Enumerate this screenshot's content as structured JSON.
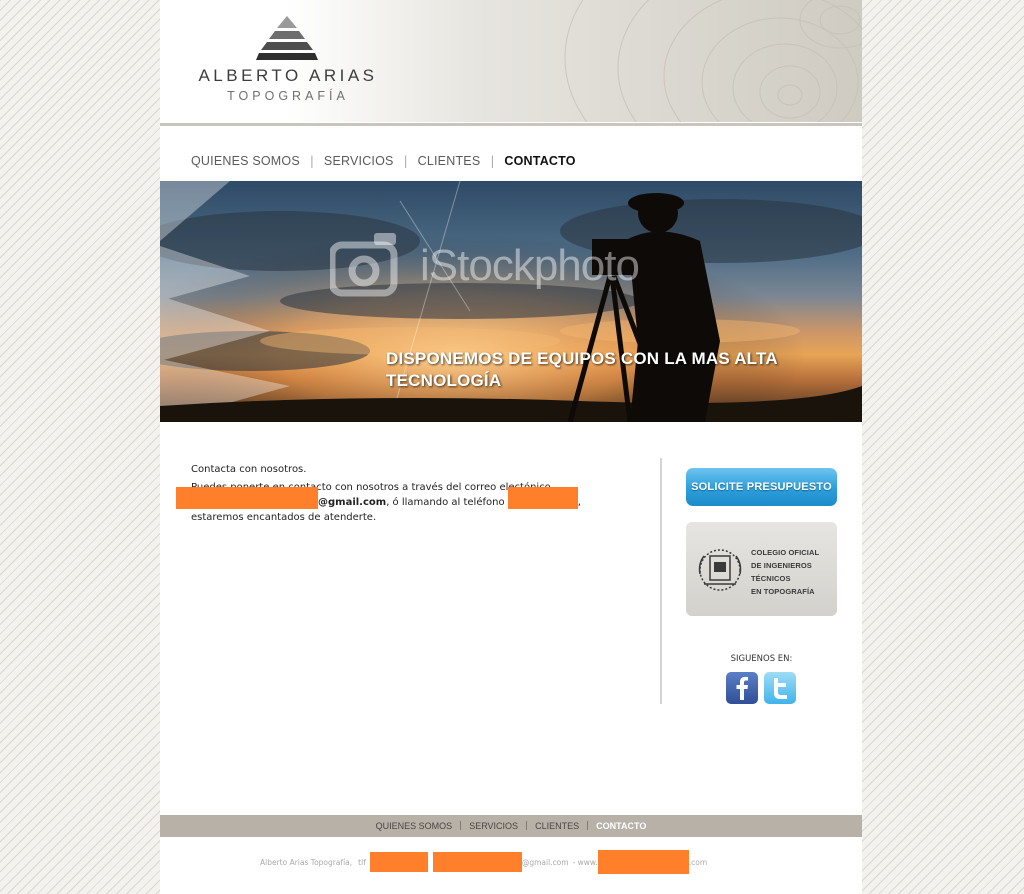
{
  "brand": {
    "name": "ALBERTO ARIAS",
    "subtitle": "TOPOGRAFÍA"
  },
  "nav": {
    "items": [
      {
        "label": "QUIENES SOMOS",
        "active": false
      },
      {
        "label": "SERVICIOS",
        "active": false
      },
      {
        "label": "CLIENTES",
        "active": false
      },
      {
        "label": "CONTACTO",
        "active": true
      }
    ],
    "separator": "|"
  },
  "hero": {
    "watermark": "iStockphoto",
    "headline_line1": "DISPONEMOS DE EQUIPOS CON LA MAS ALTA",
    "headline_line2": "TECNOLOGÍA"
  },
  "content": {
    "intro": "Contacta con nosotros.",
    "para_part1": "Puedes ponerte en contacto con nosotros a través del correo electónico",
    "email_suffix": "@gmail.com",
    "para_part2": ", ó llamando al teléfono",
    "para_part3": ",",
    "para_part4": "estaremos encantados de atenderte."
  },
  "sidebar": {
    "quote_button": "SOLICITE PRESUPUESTO",
    "college_line1": "COLEGIO OFICIAL",
    "college_line2": "DE INGENIEROS",
    "college_line3": "TÉCNICOS",
    "college_line4": "EN TOPOGRAFÍA",
    "follow_label": "SIGUENOS EN:"
  },
  "footer": {
    "nav": [
      "QUIENES SOMOS",
      "SERVICIOS",
      "CLIENTES",
      "CONTACTO"
    ],
    "separator": "|",
    "company": "Alberto Arias Topografía,",
    "phone_label": "tlf",
    "email_suffix": "@gmail.com",
    "web_prefix": "- www.",
    "web_suffix": ".com"
  },
  "colors": {
    "redaction": "#ff7f2a",
    "button_blue": "#2c9edb",
    "footer_bar": "#b7b1a8"
  }
}
